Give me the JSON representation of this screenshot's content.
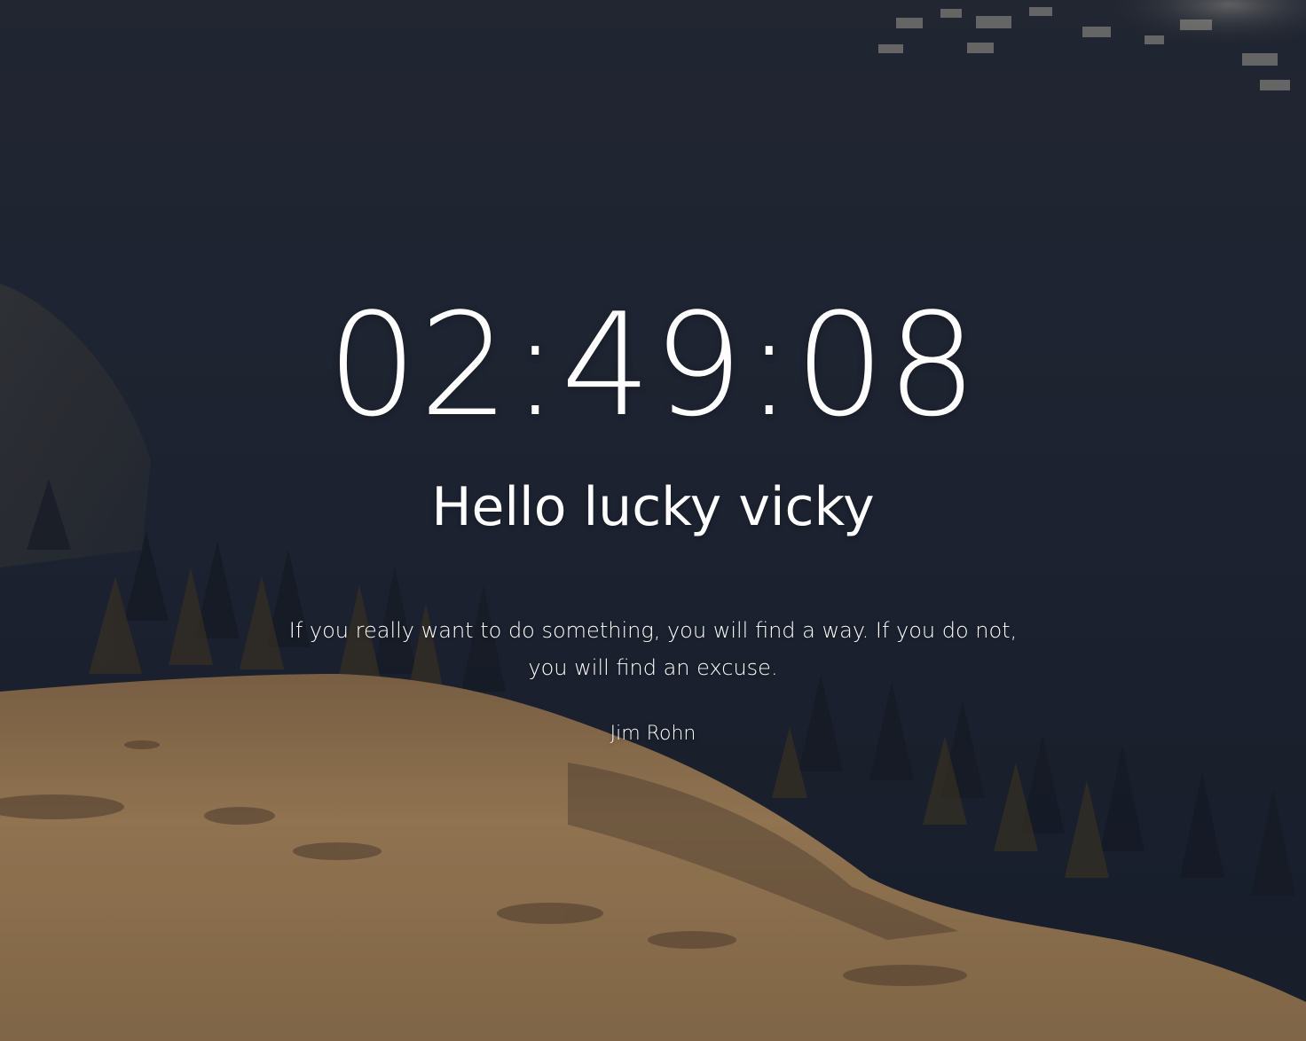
{
  "clock": {
    "time": "02:49:08"
  },
  "greeting": {
    "text": "Hello lucky vicky"
  },
  "quote": {
    "text": "If you really want to do something, you will find a way. If you do not, you will find an excuse.",
    "author": "Jim Rohn"
  },
  "background": {
    "icon": "mountain-landscape-photo",
    "colors": {
      "forest_dark": "#1b2233",
      "forest_mid": "#2a3040",
      "meadow": "#9b7a55",
      "meadow_light": "#b38f63",
      "text": "#ffffff"
    }
  }
}
